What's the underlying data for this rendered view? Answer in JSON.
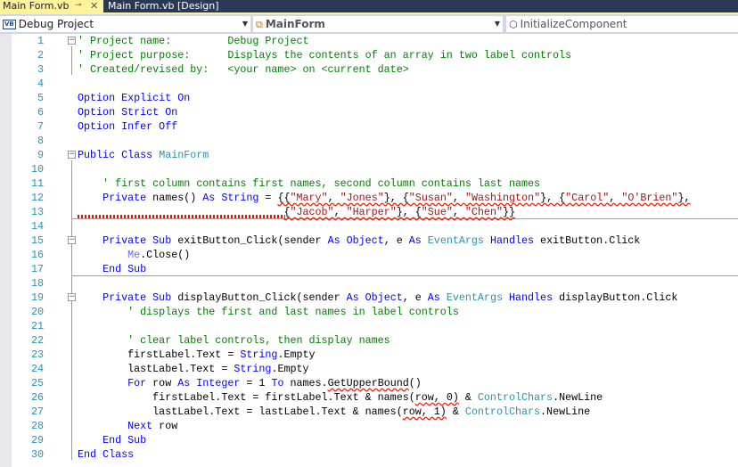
{
  "tabs": [
    {
      "label": "Main Form.vb",
      "active": true
    },
    {
      "label": "Main Form.vb [Design]",
      "active": false
    }
  ],
  "nav": {
    "project": "Debug Project",
    "class": "MainForm",
    "member": "InitializeComponent"
  },
  "colors": {
    "keyword": "#0000ff",
    "comment": "#008000",
    "string": "#a31515",
    "type": "#2b91af"
  },
  "lines": [
    [
      [
        "' Project name:         Debug Project",
        "c"
      ]
    ],
    [
      [
        "' Project purpose:      Displays the contents of an array in two label controls",
        "c"
      ]
    ],
    [
      [
        "' Created/revised by:   <your name> on <current date>",
        "c"
      ]
    ],
    [],
    [
      [
        "Option Explicit On",
        "k"
      ]
    ],
    [
      [
        "Option Strict On",
        "k"
      ]
    ],
    [
      [
        "Option Infer Off",
        "k"
      ]
    ],
    [],
    [
      [
        "Public Class ",
        "k"
      ],
      [
        "MainForm",
        "t"
      ]
    ],
    [],
    [
      [
        "    ' first column contains first names, second column contains last names",
        "c"
      ]
    ],
    [
      [
        "    ",
        ""
      ],
      [
        "Private",
        "k"
      ],
      [
        " names() ",
        ""
      ],
      [
        "As String",
        "k"
      ],
      [
        " = ",
        ""
      ],
      [
        "{{",
        "sq"
      ],
      [
        "\"Mary\"",
        "s sq"
      ],
      [
        ", ",
        "sq"
      ],
      [
        "\"Jones\"",
        "s sq"
      ],
      [
        "}, {",
        "sq"
      ],
      [
        "\"Susan\"",
        "s sq"
      ],
      [
        ", ",
        "sq"
      ],
      [
        "\"Washington\"",
        "s sq"
      ],
      [
        "}, {",
        "sq"
      ],
      [
        "\"Carol\"",
        "s sq"
      ],
      [
        ", ",
        "sq"
      ],
      [
        "\"O'Brien\"",
        "s sq"
      ],
      [
        "},",
        "sq"
      ]
    ],
    [
      [
        "                                 ",
        ""
      ],
      [
        "{",
        "sq"
      ],
      [
        "\"Jacob\"",
        "s sq"
      ],
      [
        ", ",
        "sq"
      ],
      [
        "\"Harper\"",
        "s sq"
      ],
      [
        "}, {",
        "sq"
      ],
      [
        "\"Sue\"",
        "s sq"
      ],
      [
        ", ",
        "sq"
      ],
      [
        "\"Chen\"",
        "s sq"
      ],
      [
        "}}",
        "sq"
      ]
    ],
    [],
    [
      [
        "    ",
        ""
      ],
      [
        "Private Sub",
        "k"
      ],
      [
        " exitButton_Click(sender ",
        ""
      ],
      [
        "As Object",
        "k"
      ],
      [
        ", e ",
        ""
      ],
      [
        "As ",
        "k"
      ],
      [
        "EventArgs",
        "t"
      ],
      [
        " ",
        ""
      ],
      [
        "Handles",
        "k"
      ],
      [
        " exitButton.Click",
        ""
      ]
    ],
    [
      [
        "        ",
        ""
      ],
      [
        "Me",
        "m"
      ],
      [
        ".Close()",
        ""
      ]
    ],
    [
      [
        "    ",
        ""
      ],
      [
        "End Sub",
        "k"
      ]
    ],
    [],
    [
      [
        "    ",
        ""
      ],
      [
        "Private Sub",
        "k"
      ],
      [
        " displayButton_Click(sender ",
        ""
      ],
      [
        "As Object",
        "k"
      ],
      [
        ", e ",
        ""
      ],
      [
        "As ",
        "k"
      ],
      [
        "EventArgs",
        "t"
      ],
      [
        " ",
        ""
      ],
      [
        "Handles",
        "k"
      ],
      [
        " displayButton.Click",
        ""
      ]
    ],
    [
      [
        "        ' displays the first and last names in label controls",
        "c"
      ]
    ],
    [],
    [
      [
        "        ' clear label controls, then display names",
        "c"
      ]
    ],
    [
      [
        "        firstLabel.Text = ",
        ""
      ],
      [
        "String",
        "k"
      ],
      [
        ".Empty",
        ""
      ]
    ],
    [
      [
        "        lastLabel.Text = ",
        ""
      ],
      [
        "String",
        "k"
      ],
      [
        ".Empty",
        ""
      ]
    ],
    [
      [
        "        ",
        ""
      ],
      [
        "For",
        "k"
      ],
      [
        " row ",
        ""
      ],
      [
        "As Integer",
        "k"
      ],
      [
        " = 1 ",
        ""
      ],
      [
        "To",
        "k"
      ],
      [
        " names.",
        ""
      ],
      [
        "GetUpperBound",
        "sq"
      ],
      [
        "()",
        ""
      ]
    ],
    [
      [
        "            firstLabel.Text = firstLabel.Text & names(",
        ""
      ],
      [
        "row, 0)",
        "sq"
      ],
      [
        " & ",
        ""
      ],
      [
        "ControlChars",
        "t"
      ],
      [
        ".NewLine",
        ""
      ]
    ],
    [
      [
        "            lastLabel.Text = lastLabel.Text & names(",
        ""
      ],
      [
        "row, 1)",
        "sq"
      ],
      [
        " & ",
        ""
      ],
      [
        "ControlChars",
        "t"
      ],
      [
        ".NewLine",
        ""
      ]
    ],
    [
      [
        "        ",
        ""
      ],
      [
        "Next",
        "k"
      ],
      [
        " row",
        ""
      ]
    ],
    [
      [
        "    ",
        ""
      ],
      [
        "End Sub",
        "k"
      ]
    ],
    [
      [
        "End Class",
        "k"
      ]
    ]
  ]
}
